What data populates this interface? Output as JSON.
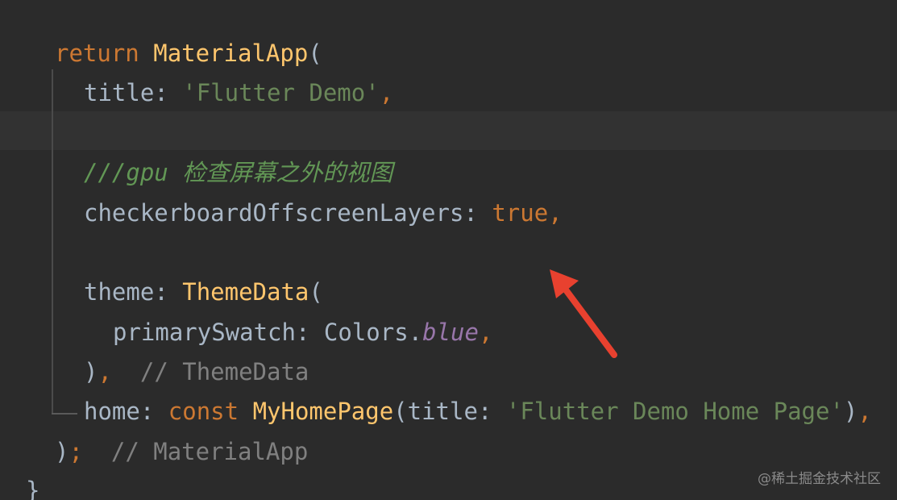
{
  "code": {
    "l1": {
      "kw": "return",
      "fn": "MaterialApp",
      "p": "("
    },
    "l2": {
      "name": "title",
      "colon": ":",
      "str": "'Flutter Demo'",
      "comma": ","
    },
    "l4": {
      "doc": "///gpu 检查屏幕之外的视图"
    },
    "l5": {
      "name": "checkerboardOffscreenLayers",
      "colon": ":",
      "val": "true",
      "comma": ","
    },
    "l7": {
      "name": "theme",
      "colon": ":",
      "fn": "ThemeData",
      "p": "("
    },
    "l8": {
      "name": "primarySwatch",
      "colon": ":",
      "cls": "Colors.",
      "field": "blue",
      "comma": ","
    },
    "l9": {
      "p": ")",
      "comma": ",",
      "cmt": "// ThemeData"
    },
    "l10": {
      "name": "home",
      "colon": ":",
      "kw": "const",
      "fn": "MyHomePage",
      "p1": "(",
      "arg": "title",
      "colon2": ":",
      "str": "'Flutter Demo Home Page'",
      "p2": ")",
      "comma": ","
    },
    "l11": {
      "p": ")",
      "semi": ";",
      "cmt": "// MaterialApp"
    },
    "l12": {
      "brace": "}"
    }
  },
  "watermark": "@稀土掘金技术社区",
  "colors": {
    "background": "#2b2b2b",
    "keyword": "#cc7832",
    "function": "#ffc66d",
    "string": "#6a8759",
    "comment": "#808080",
    "arrow": "#e8412f"
  }
}
